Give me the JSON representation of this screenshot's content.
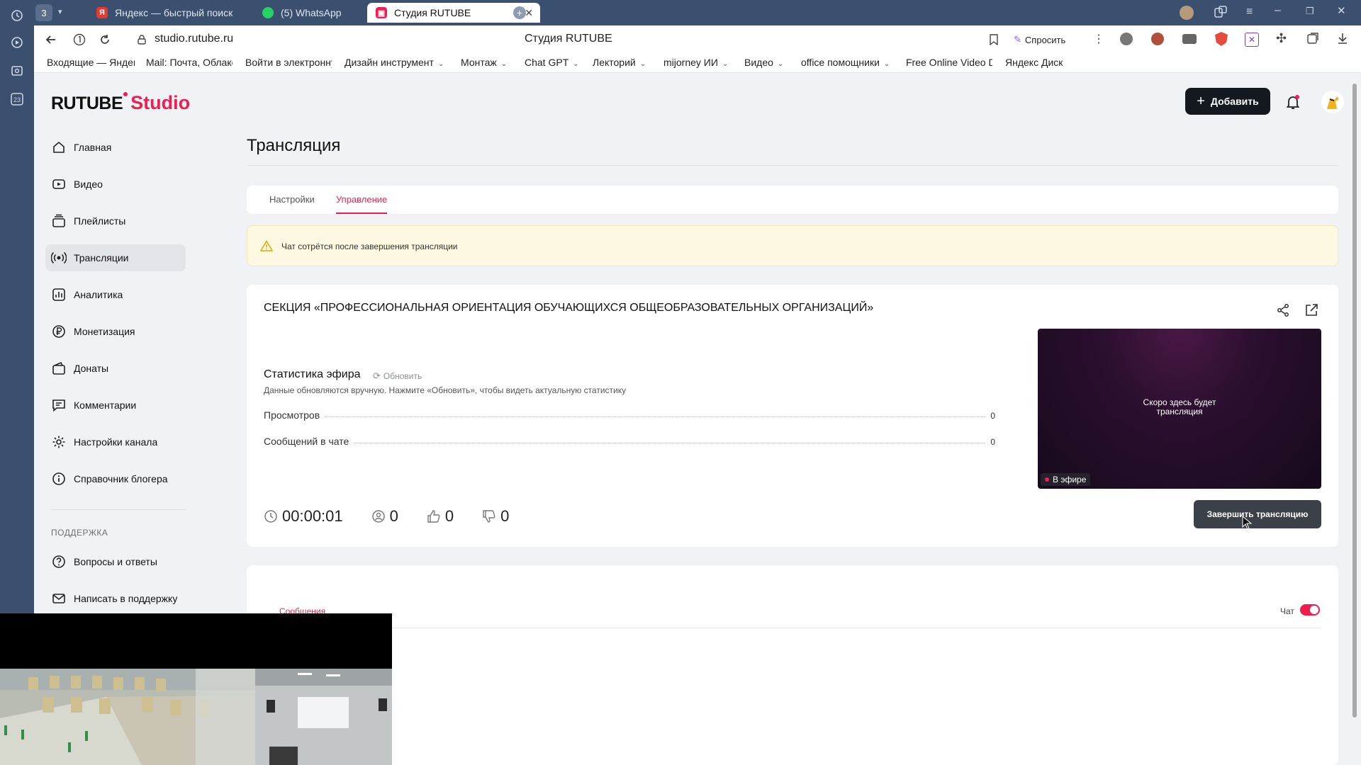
{
  "browser": {
    "tab_count": "3",
    "tabs": [
      {
        "label": "Яндекс — быстрый поиск",
        "favicon": "Я"
      },
      {
        "label": "(5) WhatsApp",
        "favicon": "whatsapp-icon"
      },
      {
        "label": "Студия RUTUBE",
        "favicon": "rutube-icon"
      }
    ],
    "url": "studio.rutube.ru",
    "page_title": "Студия RUTUBE",
    "ask_label": "Спросить",
    "rail_badge": "23",
    "bookmarks": [
      {
        "label": "Входящие — Яндекс",
        "dropdown": false
      },
      {
        "label": "Mail: Почта, Облако,",
        "dropdown": false
      },
      {
        "label": "Войти в электронну",
        "dropdown": false
      },
      {
        "label": "Дизайн инструмент",
        "dropdown": true
      },
      {
        "label": "Монтаж",
        "dropdown": true
      },
      {
        "label": "Chat GPT",
        "dropdown": true
      },
      {
        "label": "Лекторий",
        "dropdown": true
      },
      {
        "label": "mijorney ИИ",
        "dropdown": true
      },
      {
        "label": "Видео",
        "dropdown": true
      },
      {
        "label": "office помощники",
        "dropdown": true
      },
      {
        "label": "Free Online Video Do",
        "dropdown": false
      },
      {
        "label": "Яндекс Диск",
        "dropdown": false
      }
    ]
  },
  "logo": {
    "primary": "RUTUBE",
    "secondary": "Studio"
  },
  "sidebar": {
    "items": [
      {
        "label": "Главная",
        "icon": "home-icon"
      },
      {
        "label": "Видео",
        "icon": "video-icon"
      },
      {
        "label": "Плейлисты",
        "icon": "playlist-icon"
      },
      {
        "label": "Трансляции",
        "icon": "broadcast-icon"
      },
      {
        "label": "Аналитика",
        "icon": "analytics-icon"
      },
      {
        "label": "Монетизация",
        "icon": "ruble-icon"
      },
      {
        "label": "Донаты",
        "icon": "wallet-icon"
      },
      {
        "label": "Комментарии",
        "icon": "comment-icon"
      },
      {
        "label": "Настройки канала",
        "icon": "gear-icon"
      },
      {
        "label": "Справочник блогера",
        "icon": "info-icon"
      }
    ],
    "active_index": 3,
    "support_heading": "ПОДДЕРЖКА",
    "support_items": [
      {
        "label": "Вопросы и ответы",
        "icon": "question-icon"
      },
      {
        "label": "Написать в поддержку",
        "icon": "mail-icon"
      }
    ]
  },
  "header": {
    "add_label": "Добавить"
  },
  "page": {
    "title": "Трансляция",
    "tabs": [
      {
        "label": "Настройки",
        "active": false
      },
      {
        "label": "Управление",
        "active": true
      }
    ],
    "warning": "Чат сотрётся после завершения трансляции"
  },
  "stream": {
    "title": "СЕКЦИЯ «ПРОФЕССИОНАЛЬНАЯ ОРИЕНТАЦИЯ ОБУЧАЮЩИХСЯ ОБЩЕОБРАЗОВАТЕЛЬНЫХ ОРГАНИЗАЦИЙ»",
    "stats_title": "Статистика эфира",
    "refresh_label": "Обновить",
    "stats_description": "Данные обновляются вручную. Нажмите «Обновить», чтобы видеть актуальную статистику",
    "stats": [
      {
        "label": "Просмотров",
        "value": "0"
      },
      {
        "label": "Сообщений в чате",
        "value": "0"
      }
    ],
    "duration": "00:00:01",
    "viewers": "0",
    "likes": "0",
    "dislikes": "0",
    "preview_text": "Скоро здесь будет трансляция",
    "live_label": "В эфире",
    "end_button": "Завершить трансляцию"
  },
  "chat": {
    "tab_label": "Сообщения",
    "toggle_label": "Чат",
    "enabled": true
  },
  "colors": {
    "accent": "#ee1e4f",
    "dark_button": "#14191f",
    "browser_chrome": "#3b4f6e"
  }
}
